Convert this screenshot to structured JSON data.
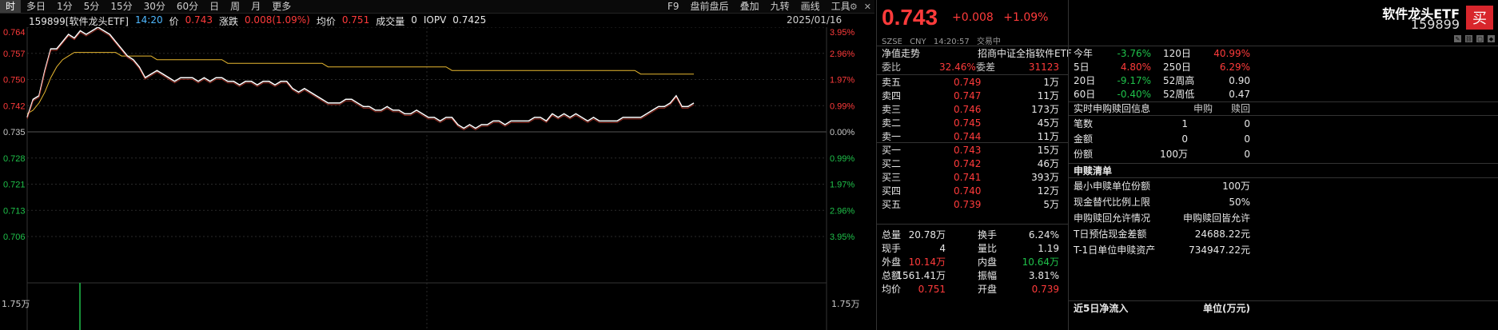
{
  "toolbar": {
    "periods": [
      "时",
      "多日",
      "1分",
      "5分",
      "15分",
      "30分",
      "60分",
      "日",
      "周",
      "月",
      "更多"
    ],
    "active_period": 0,
    "tools": [
      "F9",
      "盘前盘后",
      "叠加",
      "九转",
      "画线",
      "工具"
    ],
    "icons": [
      "gear-icon",
      "close-icon"
    ]
  },
  "chart_header": {
    "code_name": "159899[软件龙头ETF]",
    "time": "14:20",
    "price_label": "价",
    "price": "0.743",
    "change_label": "涨跌",
    "change": "0.008(1.09%)",
    "avg_label": "均价",
    "avg": "0.751",
    "vol_label": "成交量",
    "vol": "0",
    "iopv_label": "IOPV",
    "iopv": "0.7425",
    "date": "2025/01/16"
  },
  "chart_data": {
    "type": "line",
    "prev_close": 0.735,
    "ylim": [
      0.735,
      0.764
    ],
    "y_ticks": [
      "0.764",
      "0.757",
      "0.750",
      "0.742",
      "0.735",
      "0.728",
      "0.721",
      "0.713",
      "0.706"
    ],
    "pct_ticks": [
      "3.95%",
      "2.96%",
      "1.97%",
      "0.99%",
      "0.00%",
      "0.99%",
      "1.97%",
      "2.96%",
      "3.95%"
    ],
    "vol_ticks": [
      "1.75万",
      "1.75万"
    ],
    "series": [
      {
        "values": [
          0.739,
          0.744,
          0.745,
          0.752,
          0.758,
          0.758,
          0.76,
          0.762,
          0.761,
          0.763,
          0.762,
          0.763,
          0.764,
          0.763,
          0.762,
          0.76,
          0.758,
          0.756,
          0.755,
          0.753,
          0.75,
          0.751,
          0.752,
          0.751,
          0.75,
          0.749,
          0.75,
          0.75,
          0.75,
          0.749,
          0.75,
          0.749,
          0.75,
          0.75,
          0.749,
          0.749,
          0.748,
          0.749,
          0.749,
          0.748,
          0.749,
          0.749,
          0.748,
          0.749,
          0.749,
          0.747,
          0.746,
          0.747,
          0.746,
          0.745,
          0.744,
          0.743,
          0.743,
          0.743,
          0.744,
          0.744,
          0.743,
          0.742,
          0.742,
          0.741,
          0.741,
          0.742,
          0.741,
          0.741,
          0.74,
          0.74,
          0.741,
          0.74,
          0.739,
          0.739,
          0.738,
          0.739,
          0.739,
          0.737,
          0.736,
          0.737,
          0.736,
          0.737,
          0.737,
          0.738,
          0.738,
          0.737,
          0.738,
          0.738,
          0.738,
          0.738,
          0.739,
          0.739,
          0.738,
          0.74,
          0.739,
          0.74,
          0.739,
          0.74,
          0.739,
          0.738,
          0.739,
          0.738,
          0.738,
          0.738,
          0.738,
          0.739,
          0.739,
          0.739,
          0.739,
          0.74,
          0.741,
          0.742,
          0.742,
          0.743,
          0.745,
          0.742,
          0.742,
          0.743
        ]
      },
      {
        "values": [
          0.74,
          0.741,
          0.743,
          0.746,
          0.75,
          0.753,
          0.755,
          0.756,
          0.757,
          0.757,
          0.757,
          0.757,
          0.757,
          0.757,
          0.757,
          0.757,
          0.756,
          0.756,
          0.756,
          0.756,
          0.756,
          0.756,
          0.755,
          0.755,
          0.755,
          0.755,
          0.755,
          0.755,
          0.755,
          0.755,
          0.755,
          0.755,
          0.755,
          0.755,
          0.754,
          0.754,
          0.754,
          0.754,
          0.754,
          0.754,
          0.754,
          0.754,
          0.754,
          0.754,
          0.754,
          0.754,
          0.754,
          0.754,
          0.754,
          0.754,
          0.754,
          0.753,
          0.753,
          0.753,
          0.753,
          0.753,
          0.753,
          0.753,
          0.753,
          0.753,
          0.753,
          0.753,
          0.753,
          0.753,
          0.753,
          0.753,
          0.753,
          0.753,
          0.753,
          0.753,
          0.753,
          0.753,
          0.752,
          0.752,
          0.752,
          0.752,
          0.752,
          0.752,
          0.752,
          0.752,
          0.752,
          0.752,
          0.752,
          0.752,
          0.752,
          0.752,
          0.752,
          0.752,
          0.752,
          0.752,
          0.752,
          0.752,
          0.752,
          0.752,
          0.752,
          0.752,
          0.752,
          0.752,
          0.752,
          0.752,
          0.752,
          0.752,
          0.752,
          0.752,
          0.751,
          0.751,
          0.751,
          0.751,
          0.751,
          0.751,
          0.751,
          0.751,
          0.751,
          0.751
        ]
      }
    ]
  },
  "quote": {
    "price": "0.743",
    "change": "+0.008",
    "change_pct": "+1.09%",
    "meta": [
      "SZSE",
      "CNY",
      "14:20:57",
      "交易中"
    ],
    "nav_label": "净值走势",
    "index_label": "招商中证全指软件ETF",
    "weibi_label": "委比",
    "weibi": "32.46%",
    "weicha_label": "委差",
    "weicha": "31123",
    "asks": [
      {
        "label": "卖五",
        "price": "0.749",
        "vol": "1万"
      },
      {
        "label": "卖四",
        "price": "0.747",
        "vol": "11万"
      },
      {
        "label": "卖三",
        "price": "0.746",
        "vol": "173万"
      },
      {
        "label": "卖二",
        "price": "0.745",
        "vol": "45万"
      },
      {
        "label": "卖一",
        "price": "0.744",
        "vol": "11万"
      }
    ],
    "bids": [
      {
        "label": "买一",
        "price": "0.743",
        "vol": "15万"
      },
      {
        "label": "买二",
        "price": "0.742",
        "vol": "46万"
      },
      {
        "label": "买三",
        "price": "0.741",
        "vol": "393万"
      },
      {
        "label": "买四",
        "price": "0.740",
        "vol": "12万"
      },
      {
        "label": "买五",
        "price": "0.739",
        "vol": "5万"
      }
    ],
    "stats": [
      {
        "l1": "总量",
        "v1": "20.78万",
        "c1": "white",
        "l2": "换手",
        "v2": "6.24%",
        "c2": "white"
      },
      {
        "l1": "现手",
        "v1": "4",
        "c1": "white",
        "l2": "量比",
        "v2": "1.19",
        "c2": "white"
      },
      {
        "l1": "外盘",
        "v1": "10.14万",
        "c1": "up",
        "l2": "内盘",
        "v2": "10.64万",
        "c2": "down"
      },
      {
        "l1": "总额",
        "v1": "1561.41万",
        "c1": "white",
        "l2": "振幅",
        "v2": "3.81%",
        "c2": "white"
      },
      {
        "l1": "均价",
        "v1": "0.751",
        "c1": "up",
        "l2": "开盘",
        "v2": "0.739",
        "c2": "up"
      }
    ]
  },
  "right": {
    "name": "软件龙头ETF",
    "code": "159899",
    "buy_label": "买",
    "perf": [
      {
        "l1": "今年",
        "v1": "-3.76%",
        "c1": "down",
        "l2": "120日",
        "v2": "40.99%",
        "c2": "up"
      },
      {
        "l1": "5日",
        "v1": "4.80%",
        "c1": "up",
        "l2": "250日",
        "v2": "6.29%",
        "c2": "up"
      },
      {
        "l1": "20日",
        "v1": "-9.17%",
        "c1": "down",
        "l2": "52周高",
        "v2": "0.90",
        "c2": "white"
      },
      {
        "l1": "60日",
        "v1": "-0.40%",
        "c1": "down",
        "l2": "52周低",
        "v2": "0.47",
        "c2": "white"
      }
    ],
    "sr_title": "实时申购赎回信息",
    "sr_col1": "申购",
    "sr_col2": "赎回",
    "sr_rows": [
      {
        "label": "笔数",
        "v1": "1",
        "v2": "0"
      },
      {
        "label": "金额",
        "v1": "0",
        "v2": "0"
      },
      {
        "label": "份额",
        "v1": "100万",
        "v2": "0"
      }
    ],
    "list_title": "申赎清单",
    "list_rows": [
      {
        "label": "最小申赎单位份额",
        "value": "100万"
      },
      {
        "label": "现金替代比例上限",
        "value": "50%"
      },
      {
        "label": "申购赎回允许情况",
        "value": "申购赎回皆允许"
      },
      {
        "label": "T日预估现金差额",
        "value": "24688.22元"
      },
      {
        "label": "T-1日单位申赎资产",
        "value": "734947.22元"
      }
    ],
    "flow_title": "近5日净流入",
    "flow_unit": "单位(万元)"
  },
  "colors": {
    "up": "#ff3b3b",
    "down": "#1fc14a",
    "avg_line": "#e8b830",
    "price_line": "#ffffff",
    "panel_bg": "#000000"
  }
}
